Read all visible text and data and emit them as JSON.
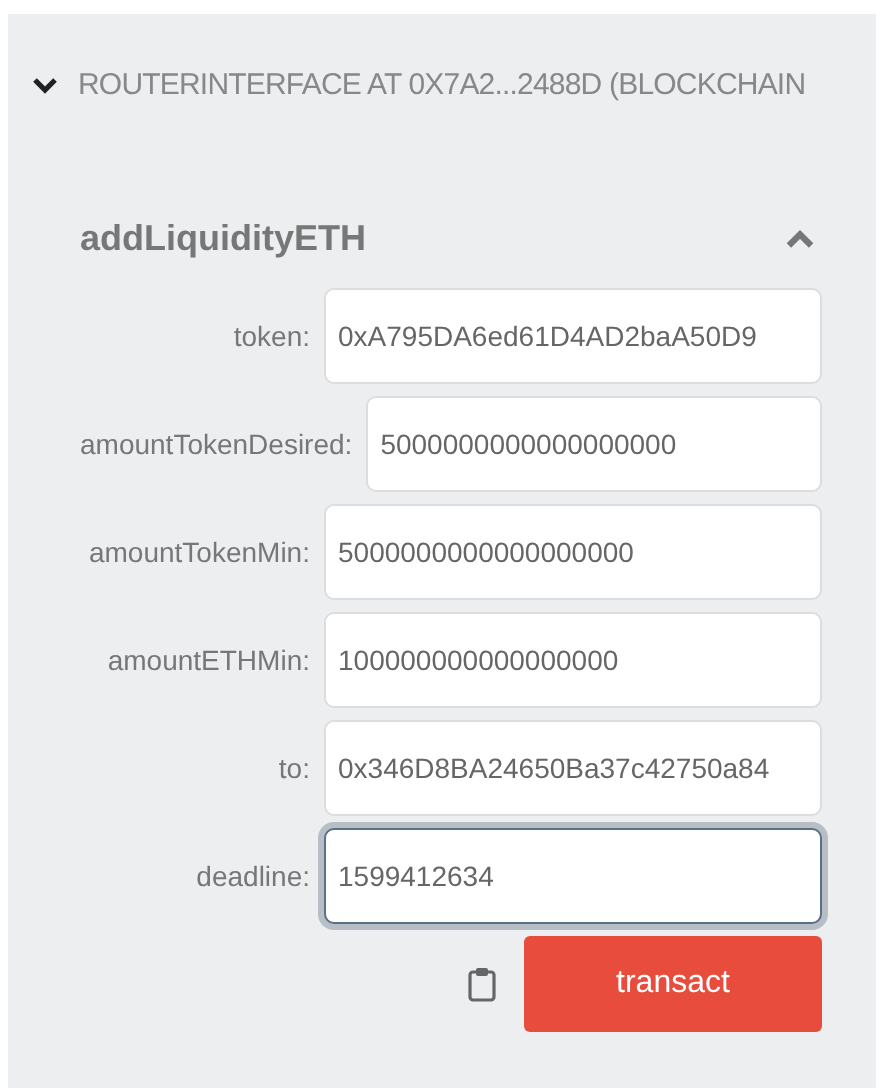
{
  "contract": {
    "title": "ROUTERINTERFACE AT 0X7A2...2488D (BLOCKCHAIN",
    "expanded": true
  },
  "function": {
    "name": "addLiquidityETH",
    "expanded": true
  },
  "fields": [
    {
      "label": "token:",
      "value": "0xA795DA6ed61D4AD2baA50D9",
      "focused": false
    },
    {
      "label": "amountTokenDesired:",
      "value": "5000000000000000000",
      "focused": false
    },
    {
      "label": "amountTokenMin:",
      "value": "5000000000000000000",
      "focused": false
    },
    {
      "label": "amountETHMin:",
      "value": "100000000000000000",
      "focused": false
    },
    {
      "label": "to:",
      "value": "0x346D8BA24650Ba37c42750a84",
      "focused": false
    },
    {
      "label": "deadline:",
      "value": "1599412634",
      "focused": true
    }
  ],
  "button": "transact"
}
